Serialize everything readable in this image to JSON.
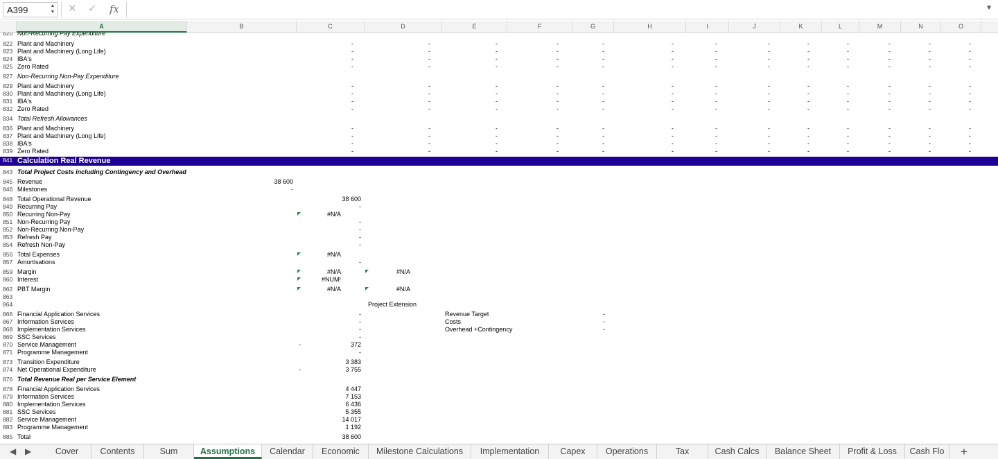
{
  "formula_bar": {
    "name_box": "A399",
    "cancel_icon": "✕",
    "enter_icon": "✓",
    "fx_label": "fx",
    "formula": ""
  },
  "columns": [
    "A",
    "B",
    "C",
    "D",
    "E",
    "F",
    "G",
    "H",
    "I",
    "J",
    "K",
    "L",
    "M",
    "N",
    "O"
  ],
  "selected_column": "A",
  "rows": [
    {
      "n": "820",
      "label": "Non-Recurring Pay Expenditure",
      "style": "italic",
      "partial": true
    },
    {
      "n": "822",
      "label": "Plant and Machinery",
      "dashes": true
    },
    {
      "n": "823",
      "label": "Plant and Machinery (Long Life)",
      "dashes": true
    },
    {
      "n": "824",
      "label": "IBA's",
      "dashes": true
    },
    {
      "n": "825",
      "label": "Zero Rated",
      "dashes": true
    },
    {
      "n": "827",
      "label": "Non-Recurring Non-Pay Expenditure",
      "style": "italic"
    },
    {
      "n": "829",
      "label": "Plant and Machinery",
      "dashes": true
    },
    {
      "n": "830",
      "label": "Plant and Machinery (Long Life)",
      "dashes": true
    },
    {
      "n": "831",
      "label": "IBA's",
      "dashes": true
    },
    {
      "n": "832",
      "label": "Zero Rated",
      "dashes": true
    },
    {
      "n": "834",
      "label": "Total Refresh Allowances",
      "style": "italic"
    },
    {
      "n": "836",
      "label": "Plant and Machinery",
      "dashes": true
    },
    {
      "n": "837",
      "label": "Plant and Machinery (Long Life)",
      "dashes": true
    },
    {
      "n": "838",
      "label": "IBA's",
      "dashes": true
    },
    {
      "n": "839",
      "label": "Zero Rated",
      "dashes": true
    },
    {
      "n": "841",
      "label": "Calculation Real Revenue",
      "style": "band"
    },
    {
      "n": "843",
      "label": "Total Project Costs including Contingency and Overhead",
      "style": "bolditalic"
    },
    {
      "n": "845",
      "label": "Revenue",
      "b": "38 600"
    },
    {
      "n": "846",
      "label": "Milestones",
      "b": "-"
    },
    {
      "n": "848",
      "label": "Total Operational Revenue",
      "c": "38 600"
    },
    {
      "n": "849",
      "label": "Recurring Pay",
      "c": "-"
    },
    {
      "n": "850",
      "label": "Recurring Non-Pay",
      "c": "#N/A",
      "c_flag": true
    },
    {
      "n": "851",
      "label": "Non-Recurring Pay",
      "c": "-"
    },
    {
      "n": "852",
      "label": "Non-Recurring Non-Pay",
      "c": "-"
    },
    {
      "n": "853",
      "label": "Refresh Pay",
      "c": "-"
    },
    {
      "n": "854",
      "label": "Refresh Non-Pay",
      "c": "-"
    },
    {
      "n": "856",
      "label": "Total Expenses",
      "c": "#N/A",
      "c_flag": true
    },
    {
      "n": "857",
      "label": "Amortisations",
      "c": "-"
    },
    {
      "n": "859",
      "label": "Margin",
      "c": "#N/A",
      "c_flag": true,
      "d": "#N/A",
      "d_flag": true
    },
    {
      "n": "860",
      "label": "Interest",
      "c": "#NUM!",
      "c_flag": true
    },
    {
      "n": "862",
      "label": "PBT Margin",
      "c": "#N/A",
      "c_flag": true,
      "d": "#N/A",
      "d_flag": true
    },
    {
      "n": "863",
      "label": ""
    },
    {
      "n": "864",
      "label": "",
      "d_text": "Project Extension"
    },
    {
      "n": "866",
      "label": "Financial Application Services",
      "c": "-",
      "e_text": "Revenue Target",
      "g": "-"
    },
    {
      "n": "867",
      "label": "Information Services",
      "c": "-",
      "e_text": "Costs",
      "g": "-"
    },
    {
      "n": "868",
      "label": "Implementation Services",
      "c": "-",
      "e_text": "Overhead +Contingency",
      "g": "-"
    },
    {
      "n": "869",
      "label": "SSC Services",
      "c": "-"
    },
    {
      "n": "870",
      "label": "Service Management",
      "b2": "-",
      "c": "372"
    },
    {
      "n": "871",
      "label": "Programme Management",
      "c": "-"
    },
    {
      "n": "873",
      "label": "Transition Expenditure",
      "c": "3 383"
    },
    {
      "n": "874",
      "label": "Net Operational Expenditure",
      "b2": "-",
      "c": "3 755"
    },
    {
      "n": "876",
      "label": "Total Revenue Real per Service Element",
      "style": "bolditalic"
    },
    {
      "n": "878",
      "label": "Financial Application Services",
      "c": "4 447"
    },
    {
      "n": "879",
      "label": "Information Services",
      "c": "7 153"
    },
    {
      "n": "880",
      "label": "Implementation Services",
      "c": "6 436"
    },
    {
      "n": "881",
      "label": "SSC Services",
      "c": "5 355"
    },
    {
      "n": "882",
      "label": "Service Management",
      "c": "14 017"
    },
    {
      "n": "883",
      "label": "Programme Management",
      "c": "1 192"
    },
    {
      "n": "885",
      "label": "Total",
      "c": "38 600"
    }
  ],
  "tabs": [
    "Cover",
    "Contents",
    "Sum",
    "Assumptions",
    "Calendar",
    "Economic",
    "Milestone Calculations",
    "Implementation",
    "Capex",
    "Operations",
    "Tax",
    "Cash Calcs",
    "Balance Sheet",
    "Profit & Loss",
    "Cash Flo"
  ],
  "active_tab": "Assumptions",
  "add_sheet_label": "+"
}
